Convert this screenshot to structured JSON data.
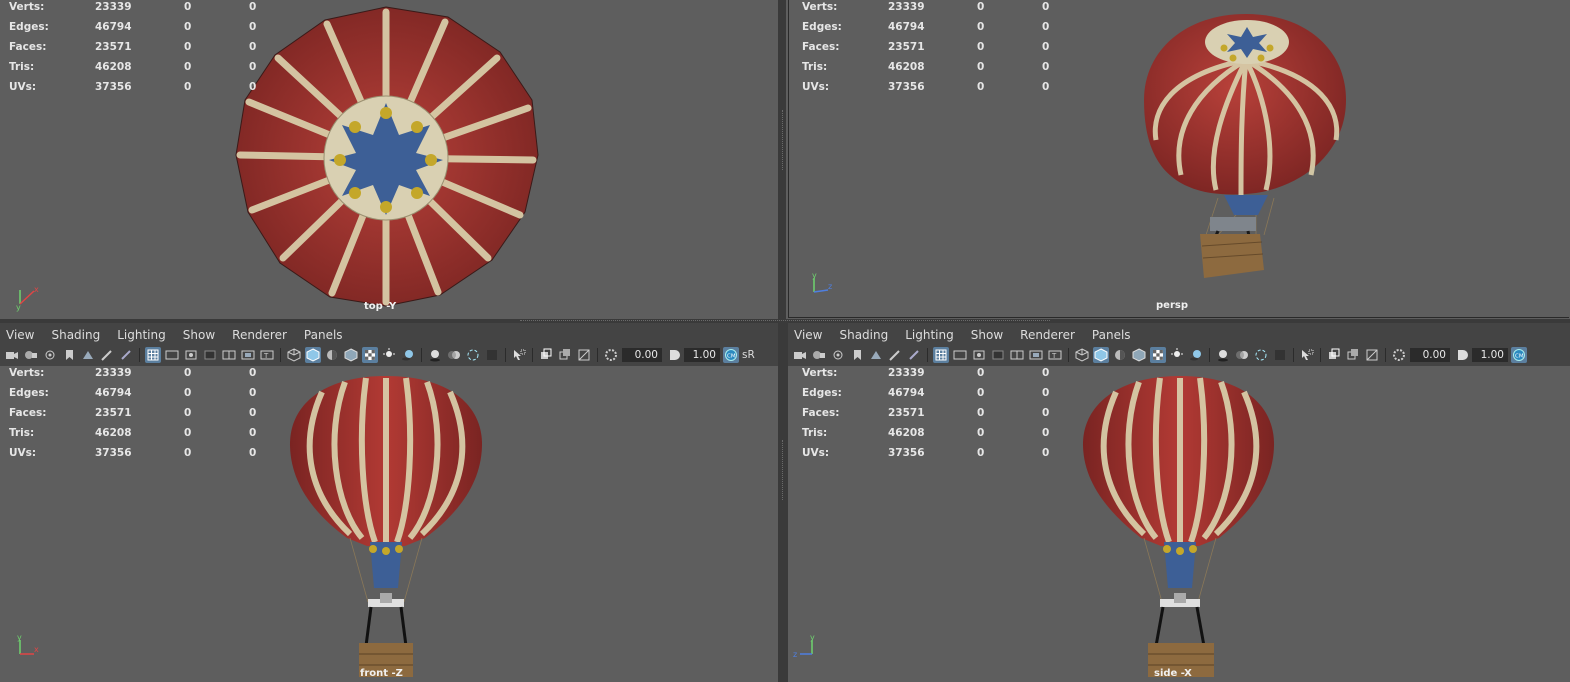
{
  "hud": {
    "rows": [
      {
        "label": "Verts:",
        "value": "23339",
        "c1": "0",
        "c2": "0"
      },
      {
        "label": "Edges:",
        "value": "46794",
        "c1": "0",
        "c2": "0"
      },
      {
        "label": "Faces:",
        "value": "23571",
        "c1": "0",
        "c2": "0"
      },
      {
        "label": "Tris:",
        "value": "46208",
        "c1": "0",
        "c2": "0"
      },
      {
        "label": "UVs:",
        "value": "37356",
        "c1": "0",
        "c2": "0"
      }
    ]
  },
  "viewports": {
    "top": {
      "camera": "top -Y"
    },
    "persp": {
      "camera": "persp"
    },
    "front": {
      "camera": "front -Z"
    },
    "side": {
      "camera": "side -X"
    }
  },
  "menu": [
    "View",
    "Shading",
    "Lighting",
    "Show",
    "Renderer",
    "Panels"
  ],
  "toolbar": {
    "exposure": "0.00",
    "gamma": "1.00",
    "colorspace": "sR"
  },
  "axes": {
    "top": [
      "y",
      "x"
    ],
    "persp": [
      "y",
      "z"
    ],
    "front": [
      "y",
      "x"
    ],
    "side": [
      "y",
      "z"
    ]
  },
  "colors": {
    "viewport_bg": "#5e5e5e",
    "ui_bg": "#444444",
    "balloon_red": "#a8322e",
    "balloon_cream": "#d9cfae",
    "balloon_blue": "#3d5f96",
    "accent_active": "#5b7f9f"
  },
  "icons": [
    "camera-icon",
    "film-gate-icon",
    "grid-icon",
    "wireframe-icon",
    "smooth-shade-icon",
    "lighting-icon",
    "texture-icon",
    "isolate-icon"
  ]
}
